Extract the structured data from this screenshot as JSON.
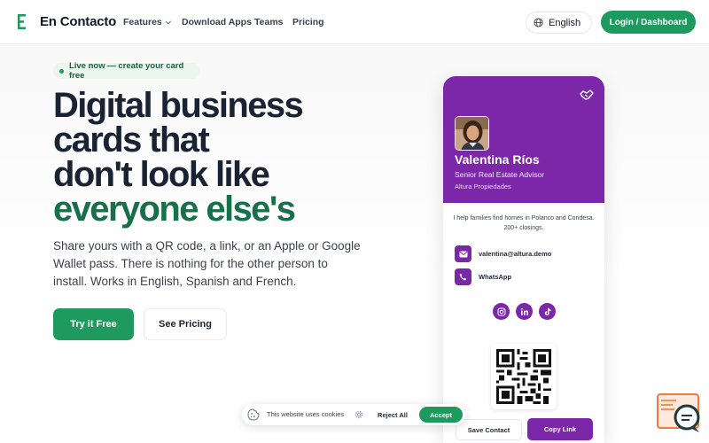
{
  "header": {
    "brand": "En Contacto",
    "nav": {
      "features": "Features",
      "download": "Download Apps",
      "teams": "Teams",
      "pricing": "Pricing"
    },
    "language": "English",
    "login": "Login / Dashboard"
  },
  "hero": {
    "badge": "Live now — create your card free",
    "headline_lines": [
      "Digital business",
      "cards that",
      "don't look like"
    ],
    "headline_accent": "everyone else's",
    "subtext": "Share yours with a QR code, a link, or an Apple or Google Wallet pass. There is nothing for the other person to install. Works in English, Spanish and French.",
    "try_button": "Try it Free",
    "pricing_button": "See Pricing"
  },
  "card": {
    "name": "Valentina Ríos",
    "role": "Senior Real Estate Advisor",
    "company": "Altura Propiedades",
    "bio": "I help families find homes in Polanco and Condesa. 200+ closings.",
    "email": "valentina@altura.demo",
    "whatsapp": "WhatsApp",
    "save_contact": "Save Contact",
    "copy_link": "Copy Link"
  },
  "cookie": {
    "text": "This website uses cookies",
    "reject": "Reject All",
    "accept": "Accept"
  },
  "colors": {
    "brand_green": "#1e9a5f",
    "accent_text_green": "#17704a",
    "card_purple": "#7b27a8",
    "headline": "#1a2333"
  },
  "icons": [
    "logo-icon",
    "chevron-down-icon",
    "globe-icon",
    "handshake-icon",
    "email-icon",
    "phone-icon",
    "instagram-icon",
    "linkedin-icon",
    "tiktok-icon",
    "qr-code-icon",
    "cookie-icon",
    "gear-icon",
    "chat-support-icon"
  ]
}
